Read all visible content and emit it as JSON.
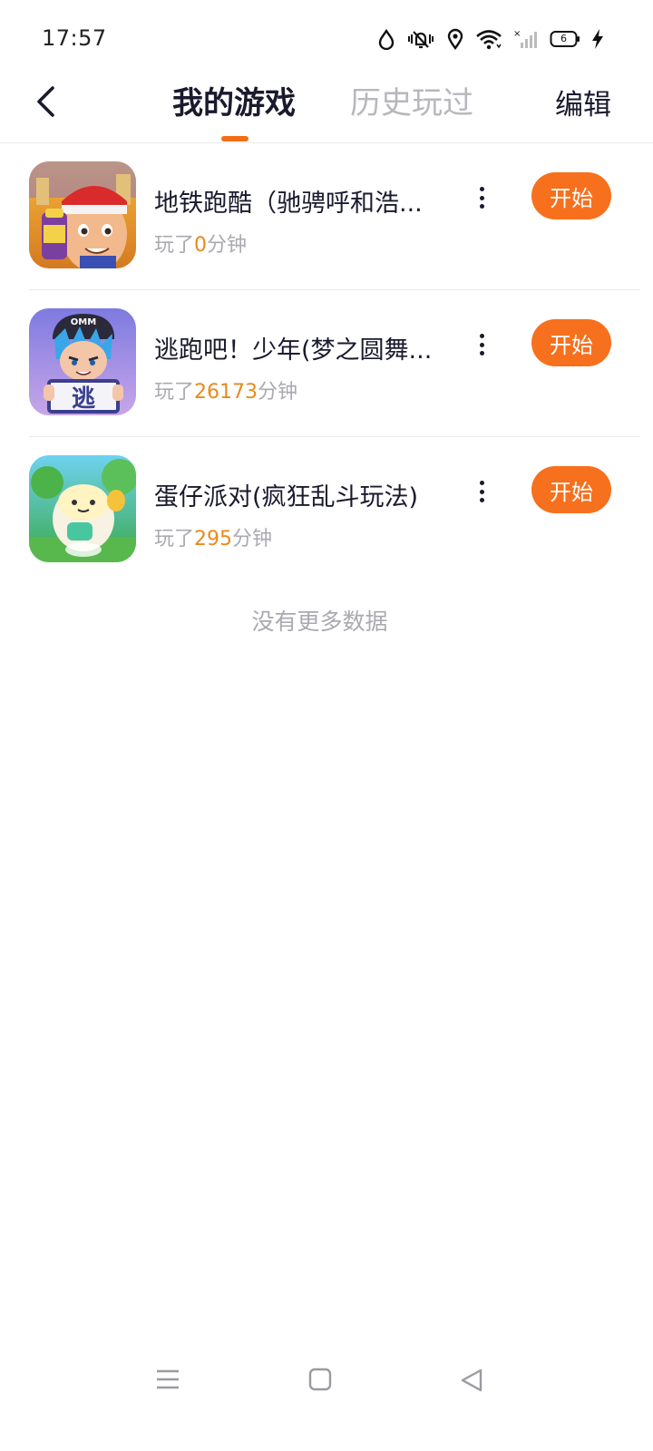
{
  "status_bar": {
    "time": "17:57",
    "battery_level": "6",
    "icons": [
      "water-drop-icon",
      "vibrate-icon",
      "location-icon",
      "wifi-icon",
      "signal-icon",
      "battery-icon",
      "charging-icon"
    ]
  },
  "header": {
    "back_icon": "chevron-left-icon",
    "tabs": [
      {
        "label": "我的游戏",
        "active": true
      },
      {
        "label": "历史玩过",
        "active": false
      }
    ],
    "edit_label": "编辑",
    "accent_color": "#f26d13"
  },
  "games": [
    {
      "title": "地铁跑酷（驰骋呼和浩...",
      "played_prefix": "玩了",
      "minutes": "0",
      "played_suffix": "分钟",
      "start_label": "开始",
      "icon": "subway-surfers-icon"
    },
    {
      "title": "逃跑吧！少年(梦之圆舞...",
      "played_prefix": "玩了",
      "minutes": "26173",
      "played_suffix": "分钟",
      "start_label": "开始",
      "icon": "escape-game-icon",
      "icon_badge_text": "逃",
      "icon_cap_text": "OMM"
    },
    {
      "title": "蛋仔派对(疯狂乱斗玩法)",
      "played_prefix": "玩了",
      "minutes": "295",
      "played_suffix": "分钟",
      "start_label": "开始",
      "icon": "eggy-party-icon"
    }
  ],
  "footer_text": "没有更多数据",
  "colors": {
    "start_button": "#f7701d",
    "minutes_highlight": "#e98a1c",
    "muted_text": "#a9a9b0"
  },
  "nav_bar": {
    "icons": [
      "menu-icon",
      "home-icon",
      "back-triangle-icon"
    ]
  }
}
